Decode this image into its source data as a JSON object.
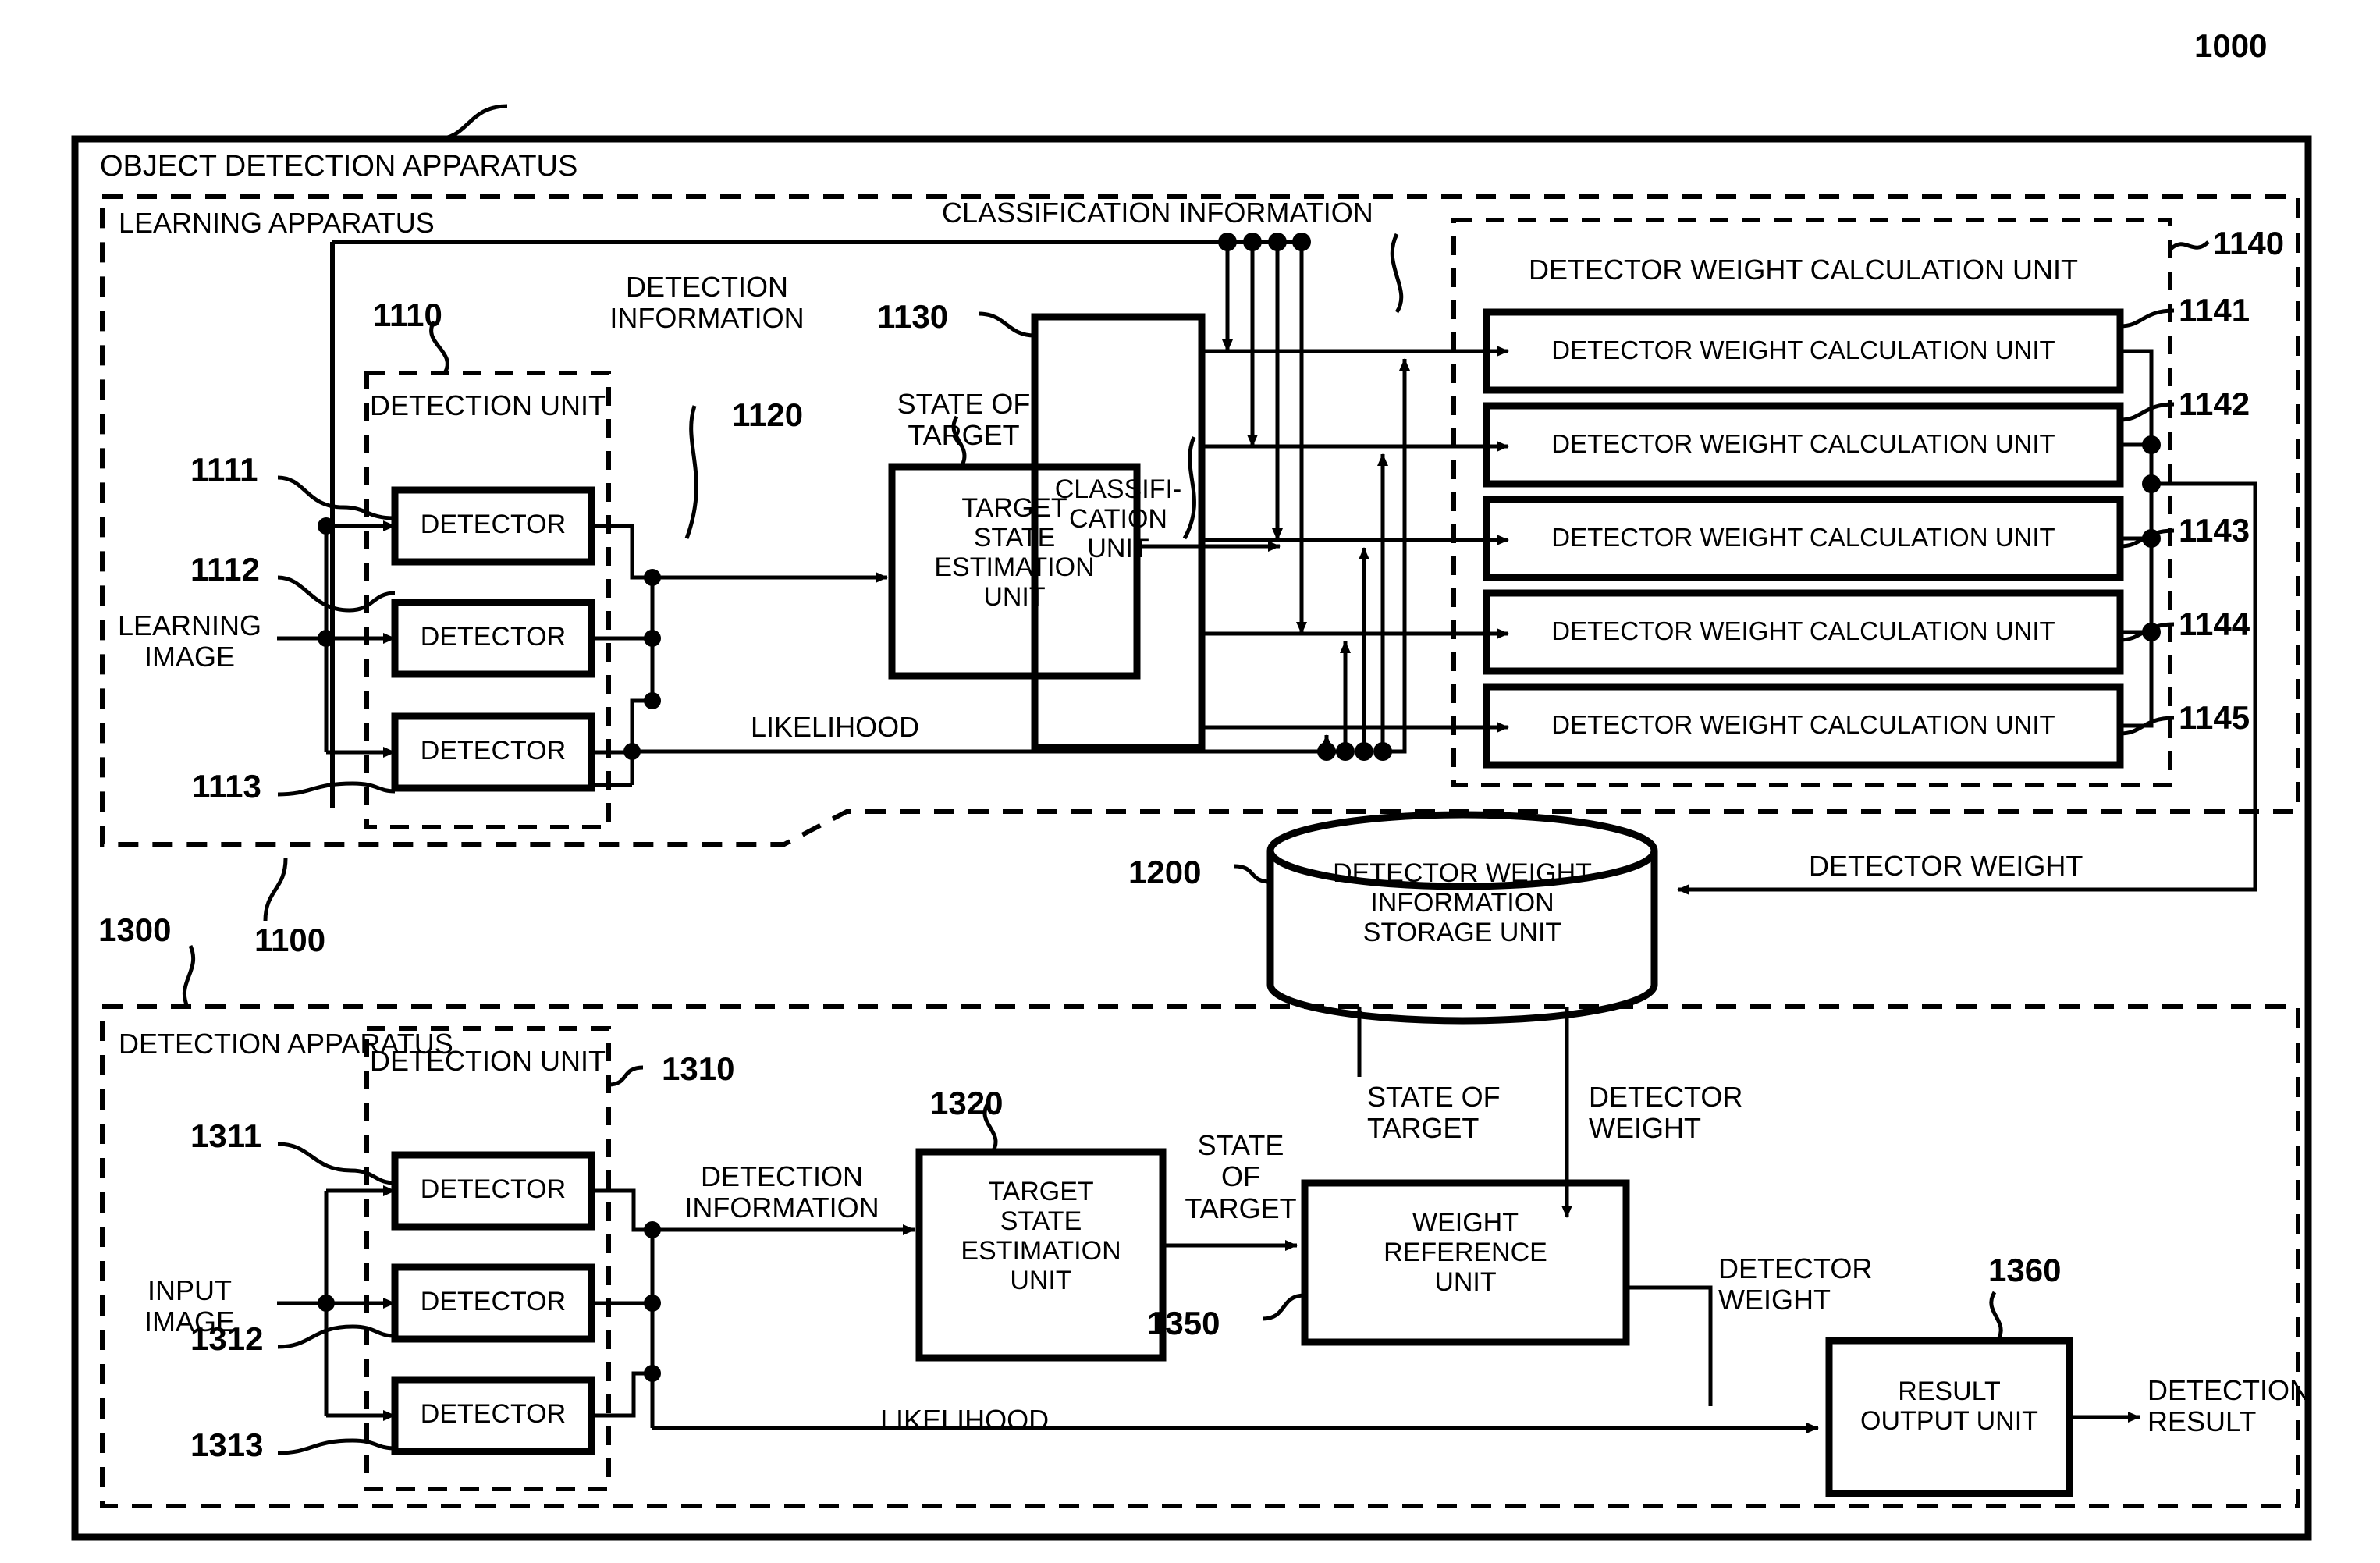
{
  "figure": {
    "outer_ref": "1000",
    "outer_title": "OBJECT DETECTION APPARATUS"
  },
  "learning_apparatus": {
    "ref": "1100",
    "title": "LEARNING APPARATUS",
    "detection_unit": {
      "ref": "1110",
      "title": "DETECTION UNIT",
      "detectors": [
        {
          "ref": "1111",
          "label": "DETECTOR"
        },
        {
          "ref": "1112",
          "label": "DETECTOR"
        },
        {
          "ref": "1113",
          "label": "DETECTOR"
        }
      ]
    },
    "input_label": "LEARNING\nIMAGE",
    "signals": {
      "detection_information": "DETECTION\nINFORMATION",
      "state_of_target": "STATE OF\nTARGET",
      "likelihood": "LIKELIHOOD",
      "classification_information": "CLASSIFICATION INFORMATION"
    },
    "target_state_estimation_unit": {
      "ref": "1120",
      "label": "TARGET\nSTATE\nESTIMATION\nUNIT"
    },
    "classification_unit": {
      "ref": "1130",
      "label": "CLASSIFI-\nCATION\nUNIT"
    },
    "detector_weight_calculation_group": {
      "ref": "1140",
      "title": "DETECTOR WEIGHT CALCULATION UNIT",
      "units": [
        {
          "ref": "1141",
          "label": "DETECTOR WEIGHT CALCULATION UNIT"
        },
        {
          "ref": "1142",
          "label": "DETECTOR WEIGHT CALCULATION UNIT"
        },
        {
          "ref": "1143",
          "label": "DETECTOR WEIGHT CALCULATION UNIT"
        },
        {
          "ref": "1144",
          "label": "DETECTOR WEIGHT CALCULATION UNIT"
        },
        {
          "ref": "1145",
          "label": "DETECTOR WEIGHT CALCULATION UNIT"
        }
      ]
    }
  },
  "storage": {
    "ref": "1200",
    "label": "DETECTOR WEIGHT\nINFORMATION\nSTORAGE UNIT",
    "incoming_signal": "DETECTOR WEIGHT"
  },
  "detection_apparatus": {
    "ref": "1300",
    "title": "DETECTION APPARATUS",
    "detection_unit": {
      "ref": "1310",
      "title": "DETECTION UNIT",
      "detectors": [
        {
          "ref": "1311",
          "label": "DETECTOR"
        },
        {
          "ref": "1312",
          "label": "DETECTOR"
        },
        {
          "ref": "1313",
          "label": "DETECTOR"
        }
      ]
    },
    "input_label": "INPUT\nIMAGE",
    "signals": {
      "detection_information": "DETECTION\nINFORMATION",
      "state_of_target_out": "STATE\nOF\nTARGET",
      "state_of_target_up": "STATE OF\nTARGET",
      "detector_weight_down": "DETECTOR\nWEIGHT",
      "detector_weight_out": "DETECTOR\nWEIGHT",
      "likelihood": "LIKELIHOOD",
      "detection_result": "DETECTION\nRESULT"
    },
    "target_state_estimation_unit": {
      "ref": "1320",
      "label": "TARGET\nSTATE\nESTIMATION\nUNIT"
    },
    "weight_reference_unit": {
      "ref": "1350",
      "label": "WEIGHT\nREFERENCE\nUNIT"
    },
    "result_output_unit": {
      "ref": "1360",
      "label": "RESULT\nOUTPUT UNIT"
    }
  },
  "style": {
    "ink": "#000000",
    "paper": "#ffffff"
  }
}
